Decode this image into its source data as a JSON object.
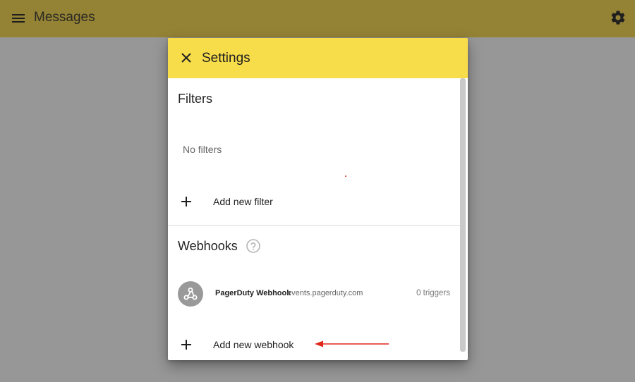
{
  "appbar": {
    "title": "Messages",
    "menu_icon": "hamburger-menu-icon",
    "settings_icon": "gear-icon",
    "color": "#948235"
  },
  "dialog": {
    "title": "Settings",
    "close_icon": "close-icon",
    "header_color": "#f8dd4b",
    "filters": {
      "heading": "Filters",
      "empty_text": "No filters",
      "add_label": "Add new filter"
    },
    "webhooks": {
      "heading": "Webhooks",
      "help_icon": "help-circle-icon",
      "items": [
        {
          "name": "PagerDuty Webhook",
          "host": "events.pagerduty.com",
          "triggers": "0 triggers",
          "icon": "webhook-icon"
        }
      ],
      "add_label": "Add new webhook"
    }
  },
  "annotation": {
    "arrow_color": "#e0261b"
  }
}
